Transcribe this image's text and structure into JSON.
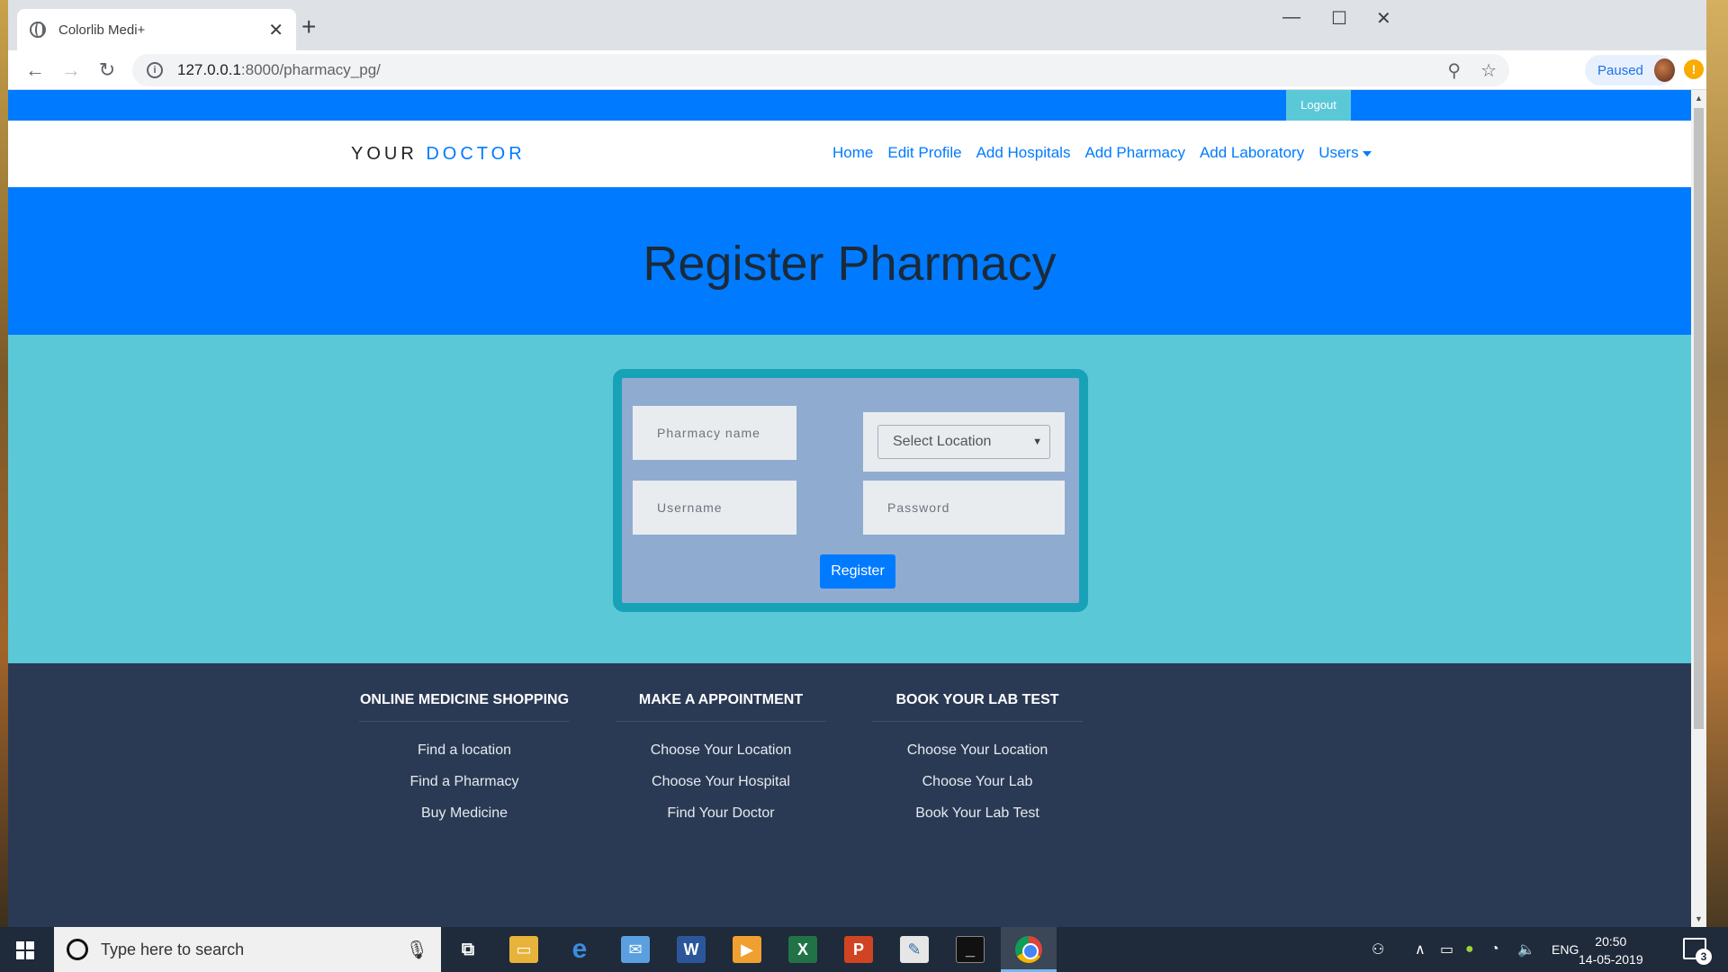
{
  "browser": {
    "tab_title": "Colorlib Medi+",
    "url_host": "127.0.0.1",
    "url_rest": ":8000/pharmacy_pg/",
    "profile_label": "Paused",
    "alert_badge": "!"
  },
  "site": {
    "logout_label": "Logout",
    "brand_word1": "YOUR",
    "brand_word2": "DOCTOR",
    "nav": [
      "Home",
      "Edit Profile",
      "Add Hospitals",
      "Add Pharmacy",
      "Add Laboratory",
      "Users"
    ],
    "page_title": "Register Pharmacy"
  },
  "form": {
    "pharmacy_name_placeholder": "Pharmacy name",
    "location_selected": "Select Location",
    "username_placeholder": "Username",
    "password_placeholder": "Password",
    "submit_label": "Register"
  },
  "footer": {
    "columns": [
      {
        "heading": "ONLINE MEDICINE SHOPPING",
        "links": [
          "Find a location",
          "Find a Pharmacy",
          "Buy Medicine"
        ]
      },
      {
        "heading": "MAKE A APPOINTMENT",
        "links": [
          "Choose Your Location",
          "Choose Your Hospital",
          "Find Your Doctor"
        ]
      },
      {
        "heading": "BOOK YOUR LAB TEST",
        "links": [
          "Choose Your Location",
          "Choose Your Lab",
          "Book Your Lab Test"
        ]
      }
    ]
  },
  "taskbar": {
    "search_placeholder": "Type here to search",
    "language": "ENG",
    "time": "20:50",
    "date": "14-05-2019",
    "notification_count": "3"
  },
  "colors": {
    "primary": "#007bff",
    "section_teal": "#5bc8d8",
    "form_border": "#17a2b8",
    "footer_bg": "#2a3a55"
  },
  "icons": [
    "globe-icon",
    "close-icon",
    "plus-icon",
    "minimize-icon",
    "maximize-icon",
    "back-icon",
    "forward-icon",
    "reload-icon",
    "info-icon",
    "zoom-icon",
    "star-icon",
    "caret-down-icon",
    "windows-icon",
    "search-ring-icon",
    "microphone-icon",
    "task-view-icon",
    "file-explorer-icon",
    "edge-icon",
    "outlook-icon",
    "word-icon",
    "media-icon",
    "excel-icon",
    "powerpoint-icon",
    "notepad-icon",
    "terminal-icon",
    "chrome-icon",
    "people-icon",
    "chevron-up-icon",
    "battery-icon",
    "shield-icon",
    "wifi-icon",
    "volume-icon",
    "notifications-icon"
  ]
}
